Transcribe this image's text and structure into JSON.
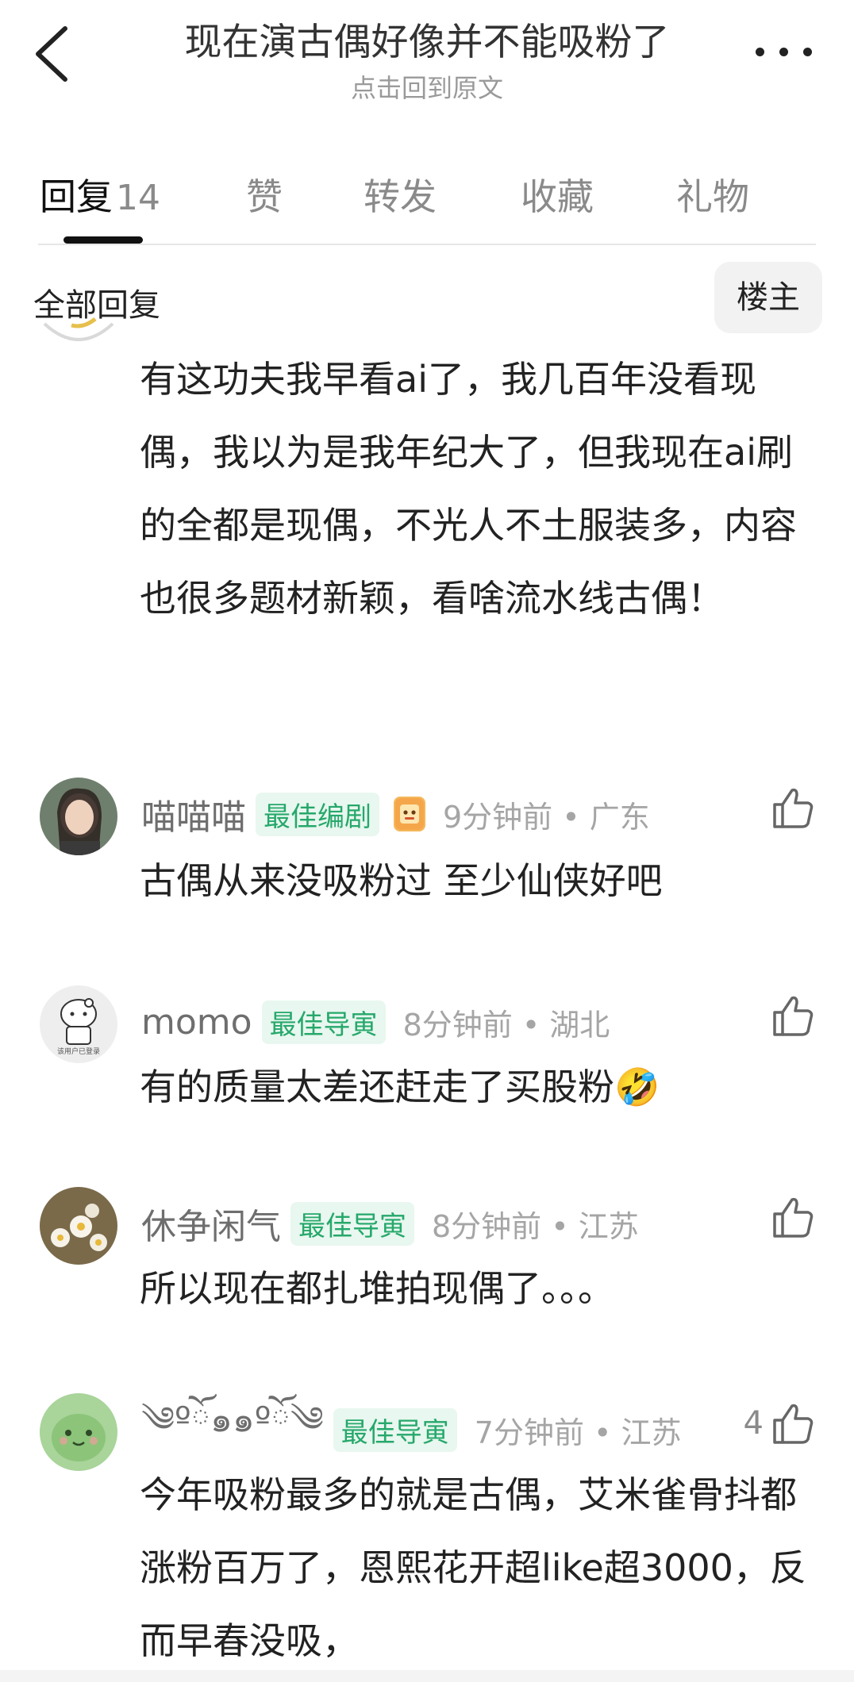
{
  "header": {
    "title": "现在演古偶好像并不能吸粉了",
    "subtitle": "点击回到原文"
  },
  "tabs": [
    {
      "label": "回复",
      "count": "14"
    },
    {
      "label": "赞"
    },
    {
      "label": "转发"
    },
    {
      "label": "收藏"
    },
    {
      "label": "礼物"
    }
  ],
  "filter": {
    "all_label": "全部回复",
    "owner_label": "楼主"
  },
  "comments": [
    {
      "text": "有这功夫我早看ai了，我几百年没看现偶，我以为是我年纪大了，但我现在ai刷的全都是现偶，不光人不土服装多，内容也很多题材新颖，看啥流水线古偶！"
    },
    {
      "username": "喵喵喵",
      "badge": "最佳编剧",
      "time": "9分钟前 • 广东",
      "text": "古偶从来没吸粉过 至少仙侠好吧"
    },
    {
      "username": "momo",
      "badge": "最佳导寅",
      "time": "8分钟前 • 湖北",
      "text": "有的质量太差还赶走了买股粉🤣"
    },
    {
      "username": "休争闲气",
      "badge": "最佳导寅",
      "time": "8分钟前 • 江苏",
      "text": "所以现在都扎堆拍现偶了。。。"
    },
    {
      "username": "༄ºོ๑๑ºོ༄",
      "badge": "最佳导寅",
      "time": "7分钟前 • 江苏",
      "likes": "4",
      "text": "今年吸粉最多的就是古偶，艾米雀骨抖都涨粉百万了，恩熙花开超like超3000，反而早春没吸，"
    }
  ],
  "colors": {
    "badge_text": "#26a86b",
    "badge_bg": "#e8f7ef",
    "muted": "#a5a5a5"
  }
}
